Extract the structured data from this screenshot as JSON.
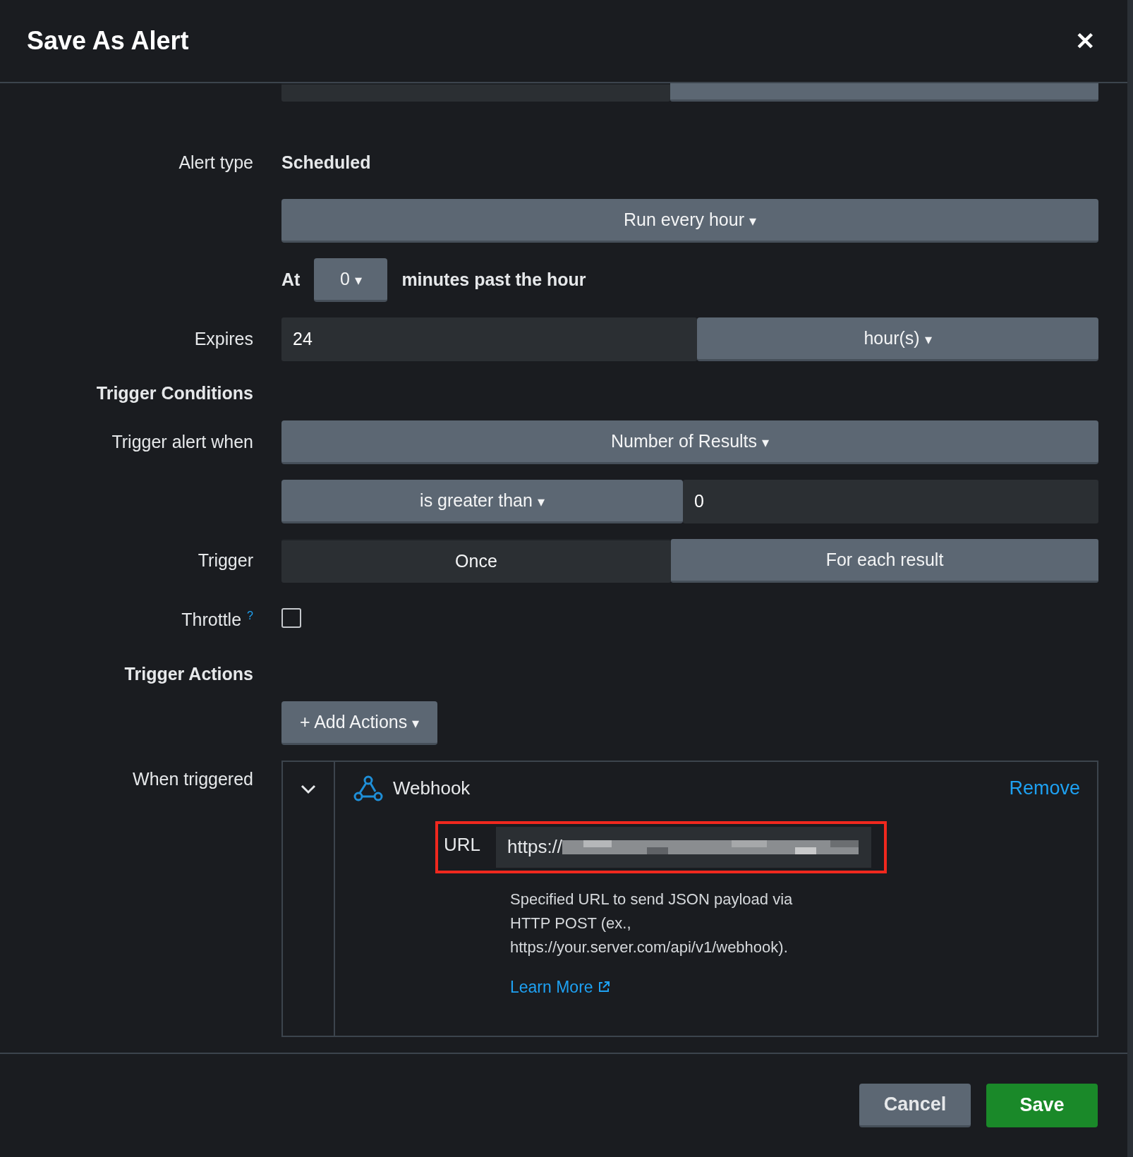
{
  "dialog": {
    "title": "Save As Alert",
    "close": "✕"
  },
  "dropdown_caret": "▾",
  "permissions": [
    {
      "selected": false
    },
    {
      "selected": true
    }
  ],
  "alert_type": {
    "label": "Alert type",
    "value": "Scheduled"
  },
  "schedule": {
    "value": "Run every hour"
  },
  "at_row": {
    "prefix": "At",
    "value": "0",
    "suffix": "minutes past the hour"
  },
  "expires": {
    "label": "Expires",
    "value": "24",
    "unit": "hour(s)"
  },
  "trigger_conditions": {
    "heading": "Trigger Conditions",
    "label": "Trigger alert when",
    "value": "Number of Results",
    "comparison": "is greater than",
    "threshold": "0"
  },
  "trigger": {
    "label": "Trigger",
    "options": [
      {
        "label": "Once",
        "selected": false
      },
      {
        "label": "For each result",
        "selected": true
      }
    ]
  },
  "throttle": {
    "label": "Throttle",
    "help": "?",
    "checked": false
  },
  "trigger_actions": {
    "heading": "Trigger Actions",
    "add_button": "+ Add Actions"
  },
  "when_triggered": {
    "label": "When triggered",
    "expanded": true,
    "action": {
      "name": "Webhook",
      "remove": "Remove",
      "url_label": "URL",
      "url_value": "https://",
      "help": "Specified URL to send JSON payload via HTTP POST (ex., https://your.server.com/api/v1/webhook).",
      "learn_more": "Learn More",
      "highlighted": true
    }
  },
  "footer": {
    "buttons": [
      {
        "label": "Cancel",
        "kind": "secondary"
      },
      {
        "label": "Save",
        "kind": "primary"
      }
    ]
  }
}
